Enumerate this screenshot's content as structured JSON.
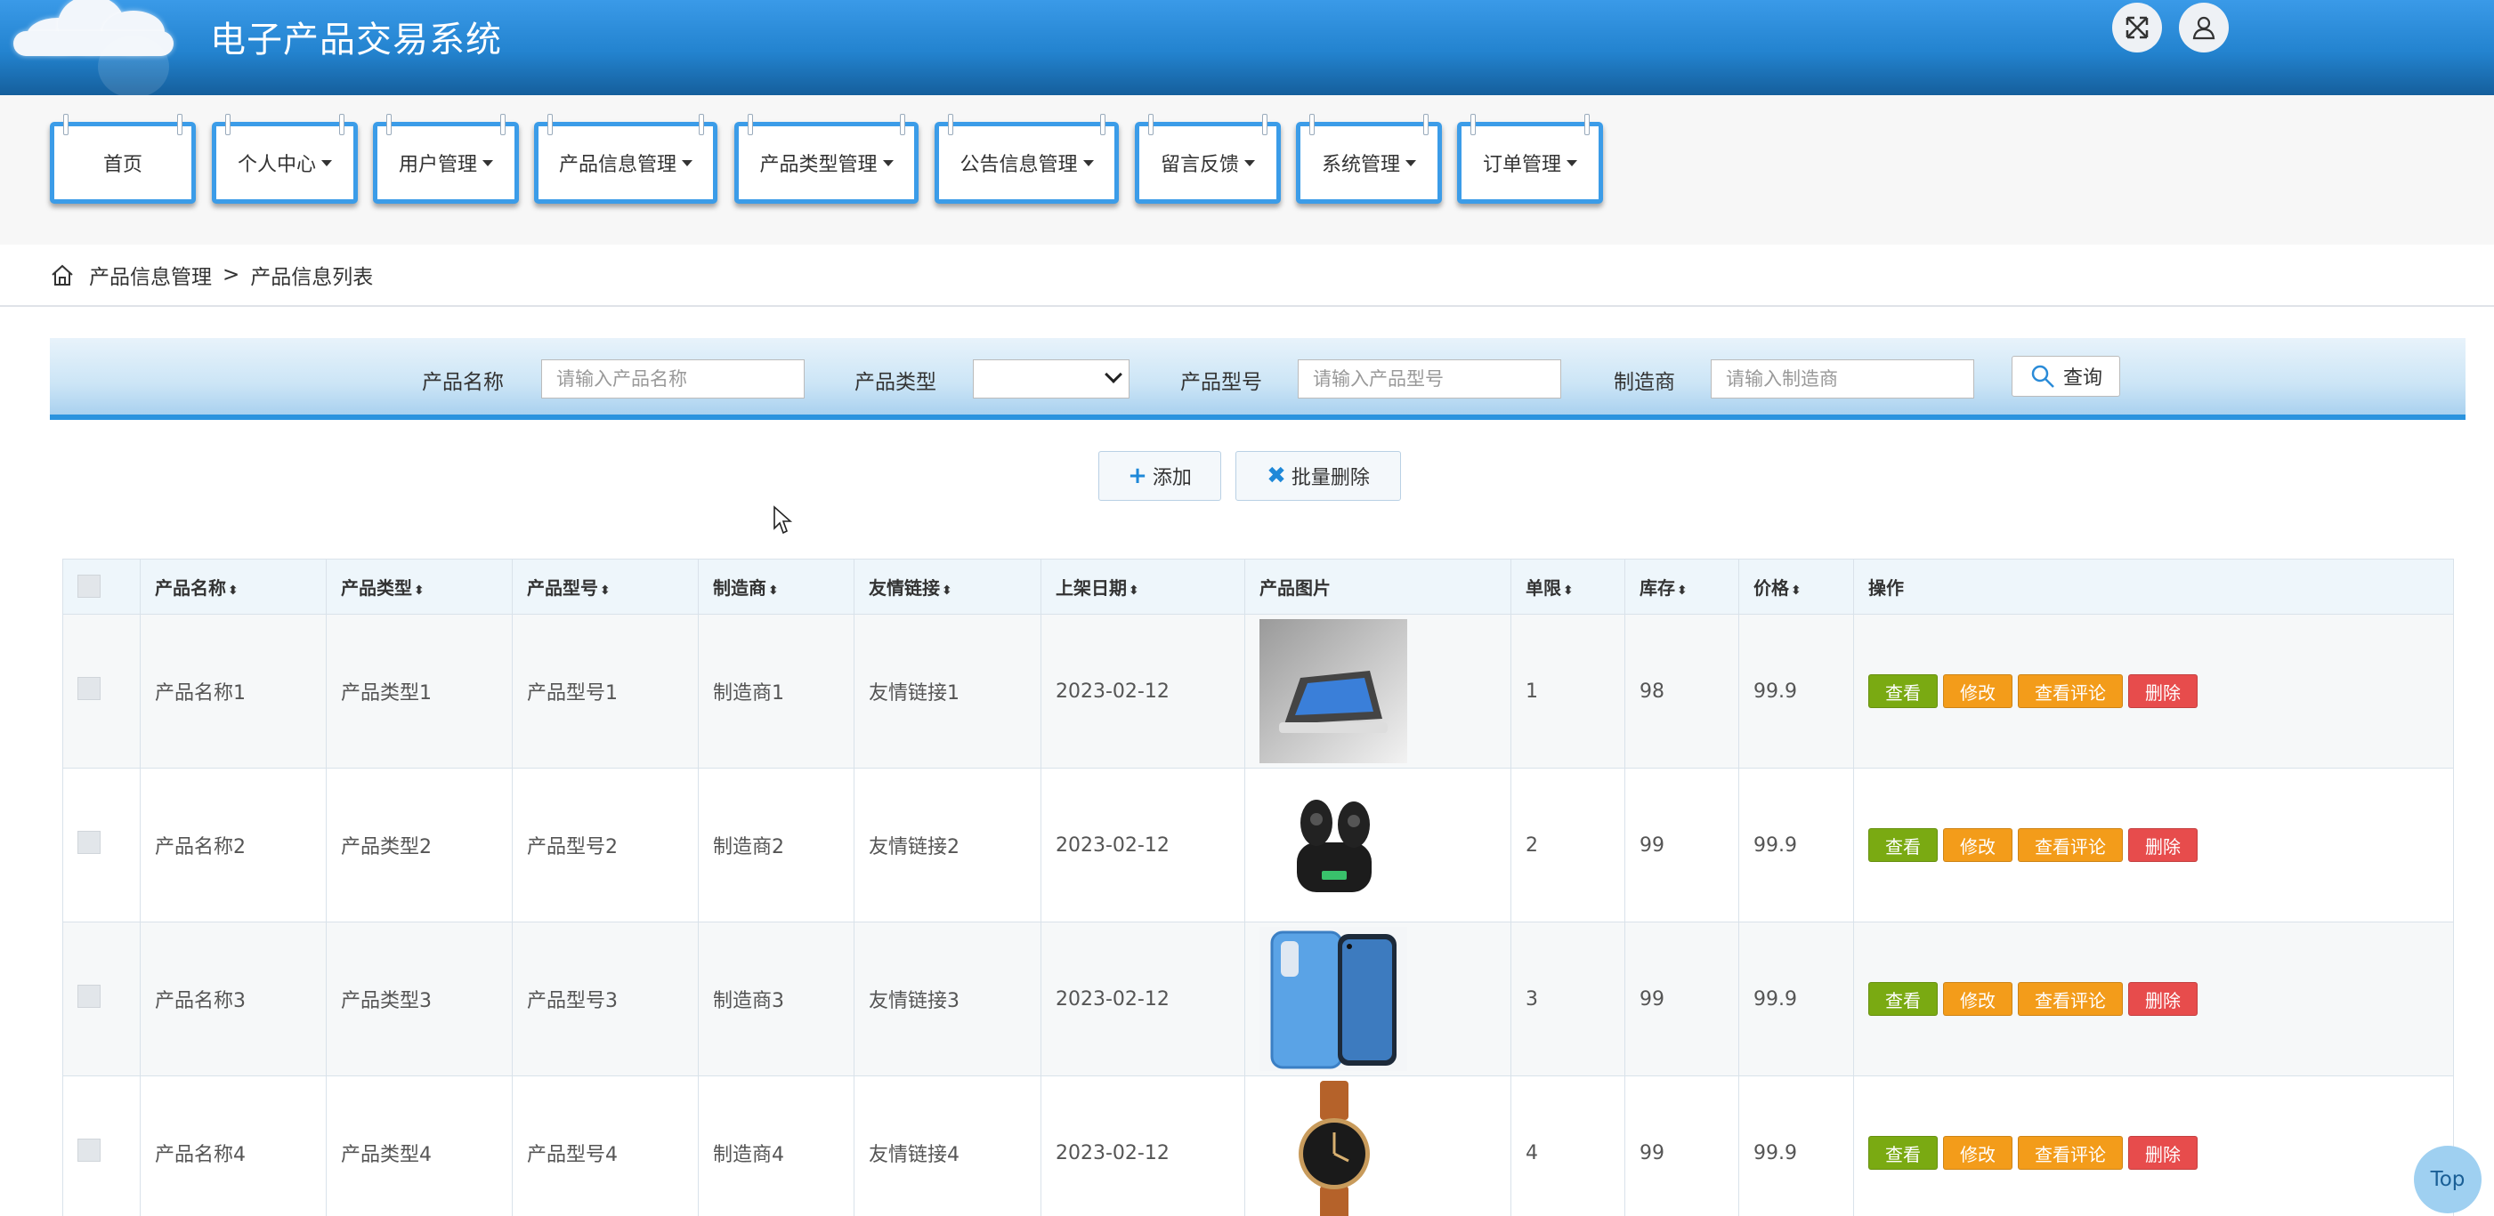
{
  "header": {
    "title": "电子产品交易系统"
  },
  "nav": {
    "items": [
      {
        "label": "首页",
        "dropdown": false
      },
      {
        "label": "个人中心",
        "dropdown": true
      },
      {
        "label": "用户管理",
        "dropdown": true
      },
      {
        "label": "产品信息管理",
        "dropdown": true
      },
      {
        "label": "产品类型管理",
        "dropdown": true
      },
      {
        "label": "公告信息管理",
        "dropdown": true
      },
      {
        "label": "留言反馈",
        "dropdown": true
      },
      {
        "label": "系统管理",
        "dropdown": true
      },
      {
        "label": "订单管理",
        "dropdown": true
      }
    ]
  },
  "breadcrumb": {
    "parent": "产品信息管理",
    "separator": ">",
    "current": "产品信息列表"
  },
  "search": {
    "name_label": "产品名称",
    "name_placeholder": "请输入产品名称",
    "type_label": "产品类型",
    "type_value": "",
    "model_label": "产品型号",
    "model_placeholder": "请输入产品型号",
    "maker_label": "制造商",
    "maker_placeholder": "请输入制造商",
    "button_label": "查询"
  },
  "actions": {
    "add_label": "添加",
    "batch_delete_label": "批量删除"
  },
  "table": {
    "columns": {
      "name": "产品名称",
      "type": "产品类型",
      "model": "产品型号",
      "maker": "制造商",
      "link": "友情链接",
      "date": "上架日期",
      "image": "产品图片",
      "limit": "单限",
      "stock": "库存",
      "price": "价格",
      "ops": "操作"
    },
    "sort_glyph": "⬍",
    "op_labels": {
      "view": "查看",
      "edit": "修改",
      "comments": "查看评论",
      "delete": "删除"
    },
    "rows": [
      {
        "name": "产品名称1",
        "type": "产品类型1",
        "model": "产品型号1",
        "maker": "制造商1",
        "link": "友情链接1",
        "date": "2023-02-12",
        "image": "tablet-display",
        "limit": "1",
        "stock": "98",
        "price": "99.9"
      },
      {
        "name": "产品名称2",
        "type": "产品类型2",
        "model": "产品型号2",
        "maker": "制造商2",
        "link": "友情链接2",
        "date": "2023-02-12",
        "image": "wireless-earbuds",
        "limit": "2",
        "stock": "99",
        "price": "99.9"
      },
      {
        "name": "产品名称3",
        "type": "产品类型3",
        "model": "产品型号3",
        "maker": "制造商3",
        "link": "友情链接3",
        "date": "2023-02-12",
        "image": "smartphones",
        "limit": "3",
        "stock": "99",
        "price": "99.9"
      },
      {
        "name": "产品名称4",
        "type": "产品类型4",
        "model": "产品型号4",
        "maker": "制造商4",
        "link": "友情链接4",
        "date": "2023-02-12",
        "image": "wristwatch",
        "limit": "4",
        "stock": "99",
        "price": "99.9"
      }
    ]
  },
  "top_button": {
    "label": "Top"
  },
  "colors": {
    "primary": "#2383cf",
    "view": "#7aaa12",
    "edit": "#f39c1a",
    "delete": "#e74c4c"
  }
}
